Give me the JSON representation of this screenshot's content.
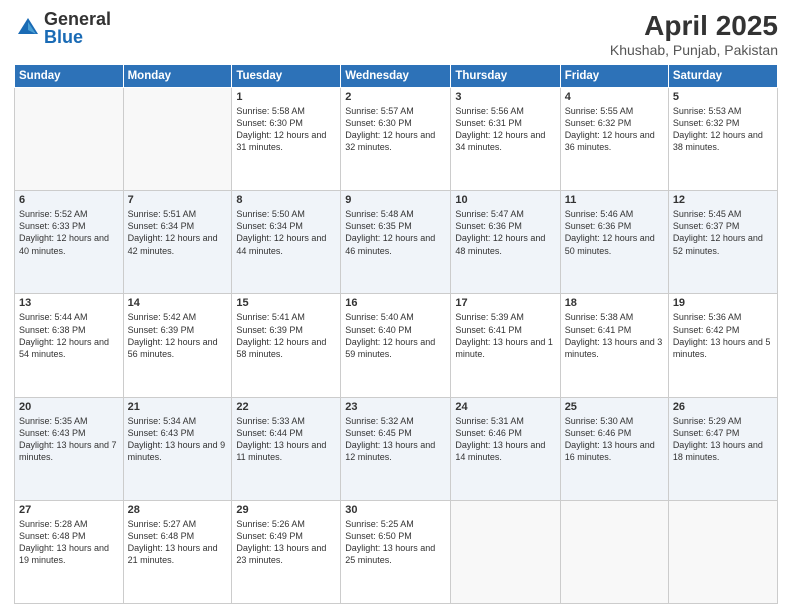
{
  "logo": {
    "general": "General",
    "blue": "Blue"
  },
  "title": "April 2025",
  "subtitle": "Khushab, Punjab, Pakistan",
  "headers": [
    "Sunday",
    "Monday",
    "Tuesday",
    "Wednesday",
    "Thursday",
    "Friday",
    "Saturday"
  ],
  "weeks": [
    [
      {
        "day": "",
        "info": ""
      },
      {
        "day": "",
        "info": ""
      },
      {
        "day": "1",
        "info": "Sunrise: 5:58 AM\nSunset: 6:30 PM\nDaylight: 12 hours and 31 minutes."
      },
      {
        "day": "2",
        "info": "Sunrise: 5:57 AM\nSunset: 6:30 PM\nDaylight: 12 hours and 32 minutes."
      },
      {
        "day": "3",
        "info": "Sunrise: 5:56 AM\nSunset: 6:31 PM\nDaylight: 12 hours and 34 minutes."
      },
      {
        "day": "4",
        "info": "Sunrise: 5:55 AM\nSunset: 6:32 PM\nDaylight: 12 hours and 36 minutes."
      },
      {
        "day": "5",
        "info": "Sunrise: 5:53 AM\nSunset: 6:32 PM\nDaylight: 12 hours and 38 minutes."
      }
    ],
    [
      {
        "day": "6",
        "info": "Sunrise: 5:52 AM\nSunset: 6:33 PM\nDaylight: 12 hours and 40 minutes."
      },
      {
        "day": "7",
        "info": "Sunrise: 5:51 AM\nSunset: 6:34 PM\nDaylight: 12 hours and 42 minutes."
      },
      {
        "day": "8",
        "info": "Sunrise: 5:50 AM\nSunset: 6:34 PM\nDaylight: 12 hours and 44 minutes."
      },
      {
        "day": "9",
        "info": "Sunrise: 5:48 AM\nSunset: 6:35 PM\nDaylight: 12 hours and 46 minutes."
      },
      {
        "day": "10",
        "info": "Sunrise: 5:47 AM\nSunset: 6:36 PM\nDaylight: 12 hours and 48 minutes."
      },
      {
        "day": "11",
        "info": "Sunrise: 5:46 AM\nSunset: 6:36 PM\nDaylight: 12 hours and 50 minutes."
      },
      {
        "day": "12",
        "info": "Sunrise: 5:45 AM\nSunset: 6:37 PM\nDaylight: 12 hours and 52 minutes."
      }
    ],
    [
      {
        "day": "13",
        "info": "Sunrise: 5:44 AM\nSunset: 6:38 PM\nDaylight: 12 hours and 54 minutes."
      },
      {
        "day": "14",
        "info": "Sunrise: 5:42 AM\nSunset: 6:39 PM\nDaylight: 12 hours and 56 minutes."
      },
      {
        "day": "15",
        "info": "Sunrise: 5:41 AM\nSunset: 6:39 PM\nDaylight: 12 hours and 58 minutes."
      },
      {
        "day": "16",
        "info": "Sunrise: 5:40 AM\nSunset: 6:40 PM\nDaylight: 12 hours and 59 minutes."
      },
      {
        "day": "17",
        "info": "Sunrise: 5:39 AM\nSunset: 6:41 PM\nDaylight: 13 hours and 1 minute."
      },
      {
        "day": "18",
        "info": "Sunrise: 5:38 AM\nSunset: 6:41 PM\nDaylight: 13 hours and 3 minutes."
      },
      {
        "day": "19",
        "info": "Sunrise: 5:36 AM\nSunset: 6:42 PM\nDaylight: 13 hours and 5 minutes."
      }
    ],
    [
      {
        "day": "20",
        "info": "Sunrise: 5:35 AM\nSunset: 6:43 PM\nDaylight: 13 hours and 7 minutes."
      },
      {
        "day": "21",
        "info": "Sunrise: 5:34 AM\nSunset: 6:43 PM\nDaylight: 13 hours and 9 minutes."
      },
      {
        "day": "22",
        "info": "Sunrise: 5:33 AM\nSunset: 6:44 PM\nDaylight: 13 hours and 11 minutes."
      },
      {
        "day": "23",
        "info": "Sunrise: 5:32 AM\nSunset: 6:45 PM\nDaylight: 13 hours and 12 minutes."
      },
      {
        "day": "24",
        "info": "Sunrise: 5:31 AM\nSunset: 6:46 PM\nDaylight: 13 hours and 14 minutes."
      },
      {
        "day": "25",
        "info": "Sunrise: 5:30 AM\nSunset: 6:46 PM\nDaylight: 13 hours and 16 minutes."
      },
      {
        "day": "26",
        "info": "Sunrise: 5:29 AM\nSunset: 6:47 PM\nDaylight: 13 hours and 18 minutes."
      }
    ],
    [
      {
        "day": "27",
        "info": "Sunrise: 5:28 AM\nSunset: 6:48 PM\nDaylight: 13 hours and 19 minutes."
      },
      {
        "day": "28",
        "info": "Sunrise: 5:27 AM\nSunset: 6:48 PM\nDaylight: 13 hours and 21 minutes."
      },
      {
        "day": "29",
        "info": "Sunrise: 5:26 AM\nSunset: 6:49 PM\nDaylight: 13 hours and 23 minutes."
      },
      {
        "day": "30",
        "info": "Sunrise: 5:25 AM\nSunset: 6:50 PM\nDaylight: 13 hours and 25 minutes."
      },
      {
        "day": "",
        "info": ""
      },
      {
        "day": "",
        "info": ""
      },
      {
        "day": "",
        "info": ""
      }
    ]
  ]
}
